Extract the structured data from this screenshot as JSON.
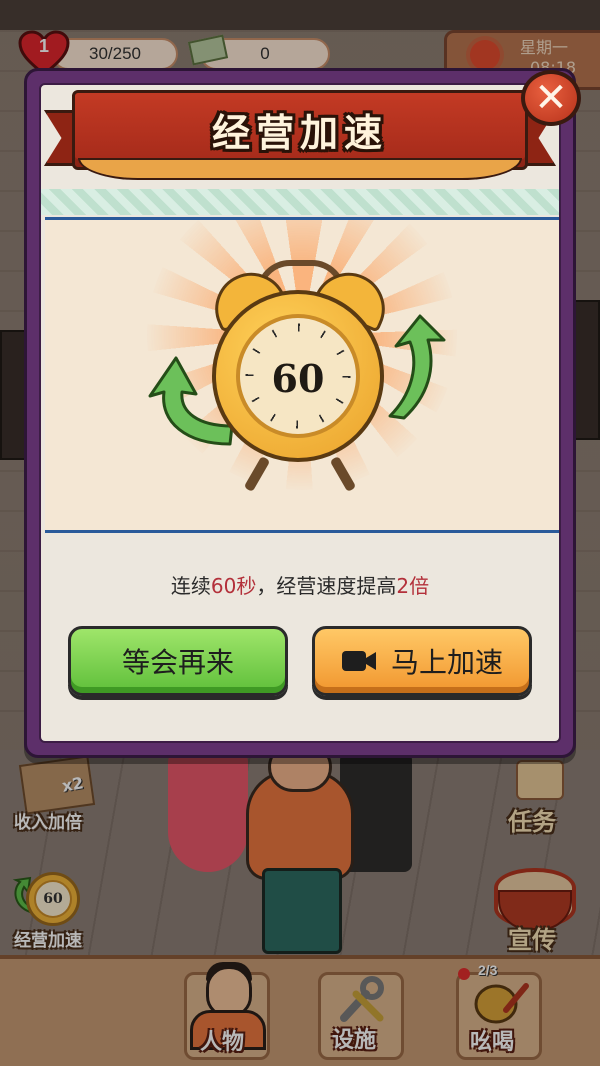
{
  "hud": {
    "heart_level": "1",
    "energy": "30/250",
    "money": "0",
    "weekday": "星期一",
    "time": "08:18"
  },
  "side": {
    "income_double": "收入加倍",
    "income_badge": "x2",
    "speed_up": "经营加速",
    "speed_clock": "60",
    "task": "任务",
    "promote": "宣传"
  },
  "bottom_nav": {
    "people": "人物",
    "facilities": "设施",
    "shout": "吆喝",
    "shout_count": "2/3"
  },
  "modal": {
    "title": "经营加速",
    "clock_number": "60",
    "desc_prefix": "连续",
    "desc_seconds": "60秒",
    "desc_middle": "，经营速度提高",
    "desc_multiplier": "2倍",
    "wait_button": "等会再来",
    "speed_button": "马上加速",
    "close_symbol": "✕"
  },
  "colors": {
    "modal_border": "#5d2f6a",
    "wait_button": "#7fd24f",
    "speed_button": "#f6ae46",
    "highlight_text": "#b3303a",
    "banner": "#b3321f"
  },
  "icons": [
    "heart-icon",
    "money-icon",
    "sun-icon",
    "close-icon",
    "alarm-clock-icon",
    "green-arrow-icon",
    "video-camera-icon",
    "drum-icon",
    "scroll-icon",
    "wrench-icon"
  ]
}
